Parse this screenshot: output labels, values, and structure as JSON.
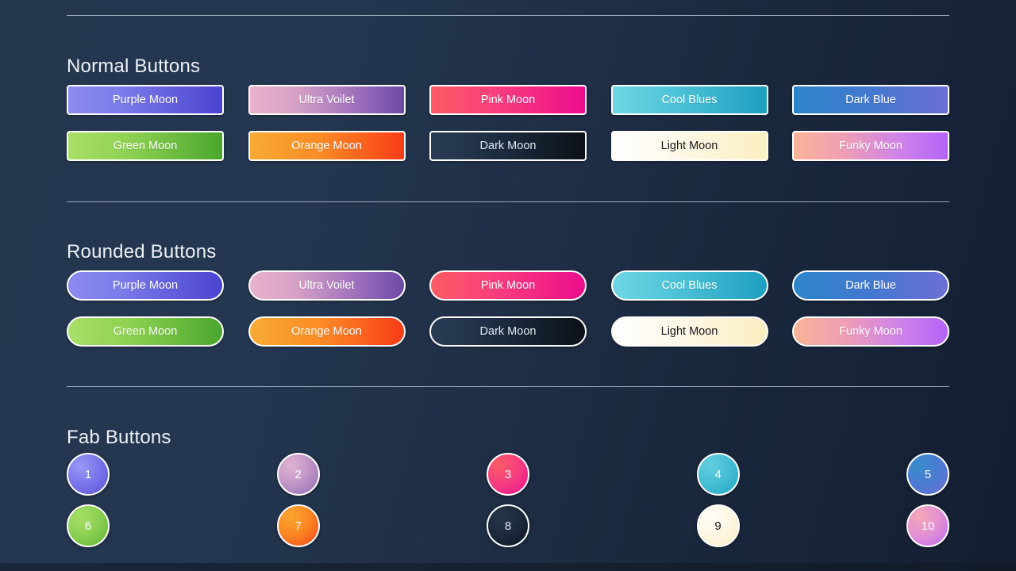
{
  "theme": {
    "background_dark": "#141e30",
    "background_light": "#24374f",
    "divider_color": "#b9c4d2",
    "title_color": "#eef1f6",
    "border_color": "#ffffff"
  },
  "sections": [
    {
      "id": "normal",
      "title": "Normal Buttons",
      "shape": "rect",
      "buttons": [
        {
          "label": "Purple Moon",
          "theme": "g-purple",
          "from": "#8b8bf0",
          "to": "#4a43cf"
        },
        {
          "label": "Ultra Voilet",
          "theme": "g-violet",
          "from": "#e9b2cd",
          "to": "#6b4aa6"
        },
        {
          "label": "Pink Moon",
          "theme": "g-pink",
          "from": "#fc5c65",
          "to": "#ec0c8c"
        },
        {
          "label": "Cool Blues",
          "theme": "g-cool",
          "from": "#6fd6e3",
          "to": "#1e9fc0"
        },
        {
          "label": "Dark Blue",
          "theme": "g-dblue",
          "from": "#2d85c9",
          "to": "#6d6fd5"
        },
        {
          "label": "Green Moon",
          "theme": "g-green",
          "from": "#a9df68",
          "to": "#4ba62d"
        },
        {
          "label": "Orange Moon",
          "theme": "g-orange",
          "from": "#f9ab34",
          "to": "#f93c17"
        },
        {
          "label": "Dark Moon",
          "theme": "g-dark",
          "from": "#2a3d55",
          "to": "#0b1016"
        },
        {
          "label": "Light Moon",
          "theme": "g-light",
          "from": "#ffffff",
          "to": "#fbeec1"
        },
        {
          "label": "Funky Moon",
          "theme": "g-funky",
          "from": "#f9b497",
          "to": "#b463f7"
        }
      ]
    },
    {
      "id": "rounded",
      "title": "Rounded Buttons",
      "shape": "pill",
      "buttons": [
        {
          "label": "Purple Moon",
          "theme": "g-purple",
          "from": "#8b8bf0",
          "to": "#4a43cf"
        },
        {
          "label": "Ultra Voilet",
          "theme": "g-violet",
          "from": "#e9b2cd",
          "to": "#6b4aa6"
        },
        {
          "label": "Pink Moon",
          "theme": "g-pink",
          "from": "#fc5c65",
          "to": "#ec0c8c"
        },
        {
          "label": "Cool Blues",
          "theme": "g-cool",
          "from": "#6fd6e3",
          "to": "#1e9fc0"
        },
        {
          "label": "Dark Blue",
          "theme": "g-dblue",
          "from": "#2d85c9",
          "to": "#6d6fd5"
        },
        {
          "label": "Green Moon",
          "theme": "g-green",
          "from": "#a9df68",
          "to": "#4ba62d"
        },
        {
          "label": "Orange Moon",
          "theme": "g-orange",
          "from": "#f9ab34",
          "to": "#f93c17"
        },
        {
          "label": "Dark Moon",
          "theme": "g-dark",
          "from": "#2a3d55",
          "to": "#0b1016"
        },
        {
          "label": "Light Moon",
          "theme": "g-light",
          "from": "#ffffff",
          "to": "#fbeec1"
        },
        {
          "label": "Funky Moon",
          "theme": "g-funky",
          "from": "#f9b497",
          "to": "#b463f7"
        }
      ]
    },
    {
      "id": "fab",
      "title": "Fab Buttons",
      "shape": "circle",
      "buttons": [
        {
          "label": "1",
          "theme": "g-purple",
          "from": "#8b8bf0",
          "to": "#4a43cf"
        },
        {
          "label": "2",
          "theme": "g-violet",
          "from": "#e9b2cd",
          "to": "#6b4aa6"
        },
        {
          "label": "3",
          "theme": "g-pink",
          "from": "#fc5c65",
          "to": "#ec0c8c"
        },
        {
          "label": "4",
          "theme": "g-cool",
          "from": "#6fd6e3",
          "to": "#1e9fc0"
        },
        {
          "label": "5",
          "theme": "g-dblue",
          "from": "#2d85c9",
          "to": "#6d6fd5"
        },
        {
          "label": "6",
          "theme": "g-green",
          "from": "#a9df68",
          "to": "#4ba62d"
        },
        {
          "label": "7",
          "theme": "g-orange",
          "from": "#f9ab34",
          "to": "#f93c17"
        },
        {
          "label": "8",
          "theme": "g-dark",
          "from": "#2a3d55",
          "to": "#0b1016"
        },
        {
          "label": "9",
          "theme": "g-light",
          "from": "#ffffff",
          "to": "#fbeec1"
        },
        {
          "label": "10",
          "theme": "g-funky",
          "from": "#f9b497",
          "to": "#b463f7"
        }
      ]
    }
  ]
}
